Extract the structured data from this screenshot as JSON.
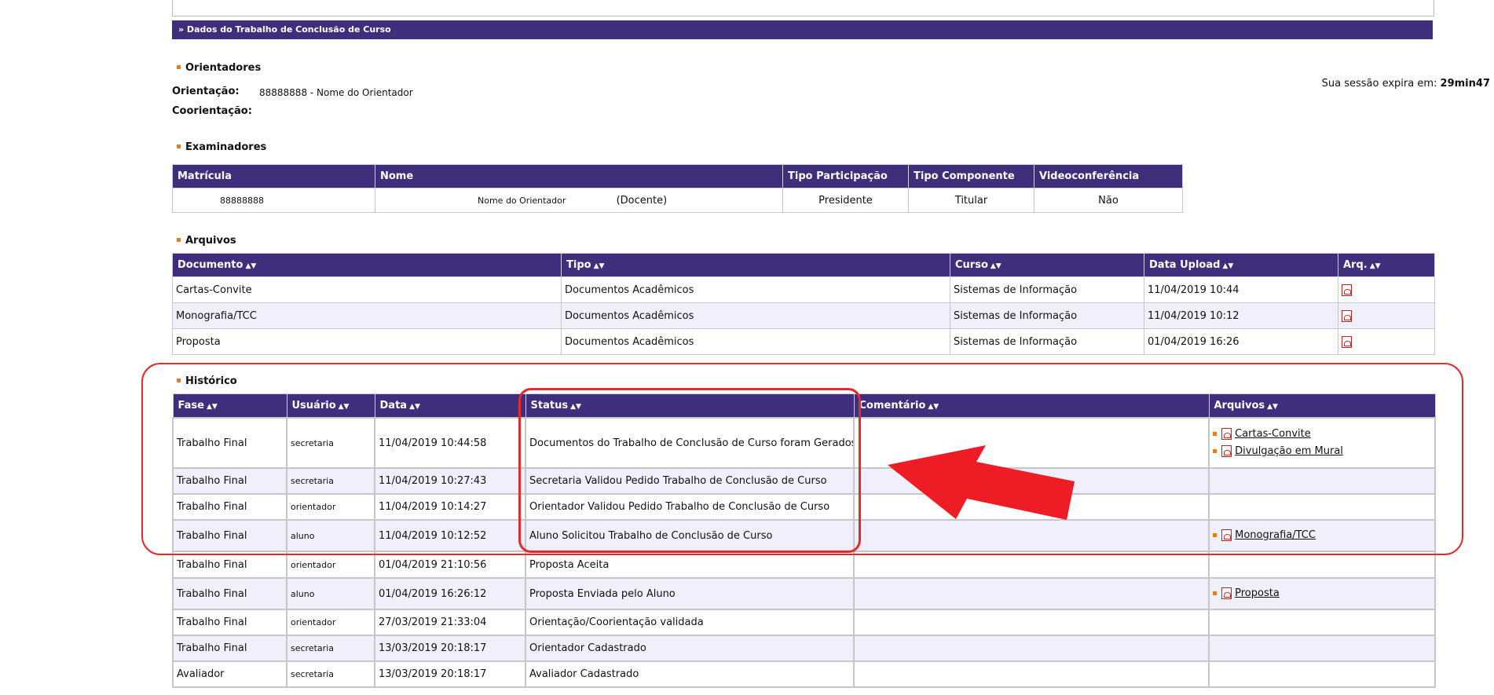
{
  "section_title": "» Dados do Trabalho de Conclusão de Curso",
  "session": {
    "label": "Sua sessão expira em:",
    "time": "29min47"
  },
  "orientadores": {
    "heading": "Orientadores",
    "orientacao_label": "Orientação:",
    "orientacao_value": "88888888 - Nome do Orientador",
    "coorientacao_label": "Coorientação:"
  },
  "examinadores": {
    "heading": "Examinadores",
    "columns": [
      "Matrícula",
      "Nome",
      "Tipo Participação",
      "Tipo Componente",
      "Videoconferência"
    ],
    "rows": [
      {
        "matricula": "88888888",
        "nome": "Nome do Orientador",
        "nome_extra": "(Docente)",
        "participacao": "Presidente",
        "componente": "Titular",
        "video": "Não"
      }
    ]
  },
  "arquivos": {
    "heading": "Arquivos",
    "columns": [
      "Documento",
      "Tipo",
      "Curso",
      "Data Upload",
      "Arq."
    ],
    "rows": [
      {
        "documento": "Cartas-Convite",
        "tipo": "Documentos Acadêmicos",
        "curso": "Sistemas de Informação",
        "data": "11/04/2019 10:44"
      },
      {
        "documento": "Monografia/TCC",
        "tipo": "Documentos Acadêmicos",
        "curso": "Sistemas de Informação",
        "data": "11/04/2019 10:12"
      },
      {
        "documento": "Proposta",
        "tipo": "Documentos Acadêmicos",
        "curso": "Sistemas de Informação",
        "data": "01/04/2019 16:26"
      }
    ]
  },
  "historico": {
    "heading": "Histórico",
    "columns": [
      "Fase",
      "Usuário",
      "Data",
      "Status",
      "Comentário",
      "Arquivos"
    ],
    "rows": [
      {
        "fase": "Trabalho Final",
        "usuario": "secretaria",
        "data": "11/04/2019 10:44:58",
        "status": "Documentos do Trabalho de Conclusão de Curso foram Gerados",
        "comentario": "",
        "arquivos": [
          "Cartas-Convite",
          "Divulgação em Mural"
        ]
      },
      {
        "fase": "Trabalho Final",
        "usuario": "secretaria",
        "data": "11/04/2019 10:27:43",
        "status": "Secretaria Validou Pedido Trabalho de Conclusão de Curso",
        "comentario": "",
        "arquivos": []
      },
      {
        "fase": "Trabalho Final",
        "usuario": "orientador",
        "data": "11/04/2019 10:14:27",
        "status": "Orientador Validou Pedido Trabalho de Conclusão de Curso",
        "comentario": "",
        "arquivos": []
      },
      {
        "fase": "Trabalho Final",
        "usuario": "aluno",
        "data": "11/04/2019 10:12:52",
        "status": "Aluno Solicitou Trabalho de Conclusão de Curso",
        "comentario": "",
        "arquivos": [
          "Monografia/TCC"
        ]
      },
      {
        "fase": "Trabalho Final",
        "usuario": "orientador",
        "data": "01/04/2019 21:10:56",
        "status": "Proposta Aceita",
        "comentario": "",
        "arquivos": []
      },
      {
        "fase": "Trabalho Final",
        "usuario": "aluno",
        "data": "01/04/2019 16:26:12",
        "status": "Proposta Enviada pelo Aluno",
        "comentario": "",
        "arquivos": [
          "Proposta"
        ]
      },
      {
        "fase": "Trabalho Final",
        "usuario": "orientador",
        "data": "27/03/2019 21:33:04",
        "status": "Orientação/Coorientação validada",
        "comentario": "",
        "arquivos": []
      },
      {
        "fase": "Trabalho Final",
        "usuario": "secretaria",
        "data": "13/03/2019 20:18:17",
        "status": "Orientador Cadastrado",
        "comentario": "",
        "arquivos": []
      },
      {
        "fase": "Avaliador",
        "usuario": "secretaria",
        "data": "13/03/2019 20:18:17",
        "status": "Avaliador Cadastrado",
        "comentario": "",
        "arquivos": []
      }
    ]
  },
  "colors": {
    "header_bg": "#3f2e7c",
    "bullet": "#f07a1a",
    "annotation": "#e42b2b",
    "alt_row": "#f0f0fc"
  },
  "icons": {
    "file": "pdf-icon",
    "bullet": "bullet-icon"
  }
}
